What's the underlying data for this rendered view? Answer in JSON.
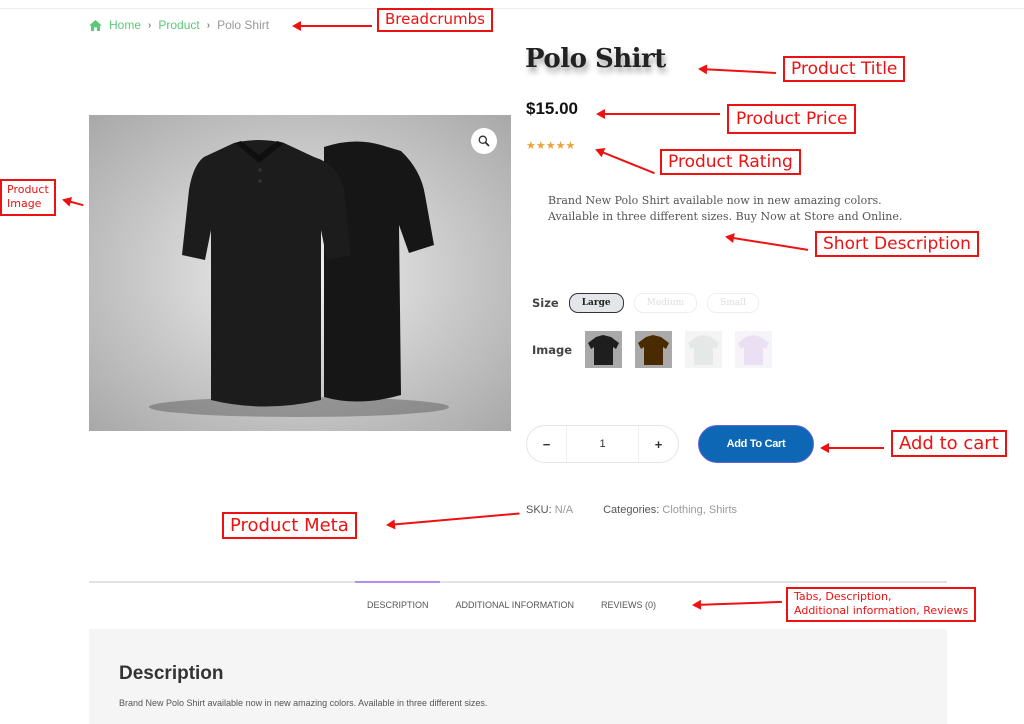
{
  "breadcrumb": {
    "home": "Home",
    "product": "Product",
    "current": "Polo Shirt",
    "separator": "›"
  },
  "product": {
    "title": "Polo Shirt",
    "price": "$15.00",
    "rating_stars": "★★★★★",
    "rating_value": 5,
    "rating_max": 5,
    "short_description_line1": "Brand New Polo Shirt available now in new amazing colors.",
    "short_description_line2": "Available in three different sizes. Buy Now at Store and Online.",
    "image_alt": "Black polo shirt front and back"
  },
  "options": {
    "size_label": "Size",
    "sizes": [
      "Large",
      "Medium",
      "Small"
    ],
    "selected_size": "Large",
    "image_label": "Image",
    "swatch_colors": [
      "#1e1e1e",
      "#4a2a00",
      "#e4e9e8",
      "#ebe0f3"
    ]
  },
  "cart": {
    "minus": "−",
    "quantity": "1",
    "plus": "+",
    "add_to_cart": "Add To Cart"
  },
  "meta": {
    "sku_label": "SKU:",
    "sku_value": "N/A",
    "categories_label": "Categories:",
    "categories_value": "Clothing, Shirts"
  },
  "tabs": {
    "items": [
      "DESCRIPTION",
      "ADDITIONAL INFORMATION",
      "REVIEWS (0)"
    ],
    "active": "DESCRIPTION"
  },
  "description": {
    "heading": "Description",
    "body": "Brand New Polo Shirt available now in new amazing colors. Available in three different sizes."
  },
  "annotations": {
    "breadcrumbs": "Breadcrumbs",
    "title": "Product Title",
    "price": "Product Price",
    "rating": "Product Rating",
    "short_desc": "Short Description",
    "image_line1": "Product",
    "image_line2": "Image",
    "add_to_cart": "Add to cart",
    "meta": "Product Meta",
    "tabs_line1": "Tabs, Description,",
    "tabs_line2": "Additional information, Reviews"
  },
  "colors": {
    "accent_green": "#5cc97a",
    "cart_blue": "#0d67b5",
    "star": "#e8a33d",
    "tab_indicator": "#b58cf0",
    "annotation_red": "#ee1111"
  }
}
